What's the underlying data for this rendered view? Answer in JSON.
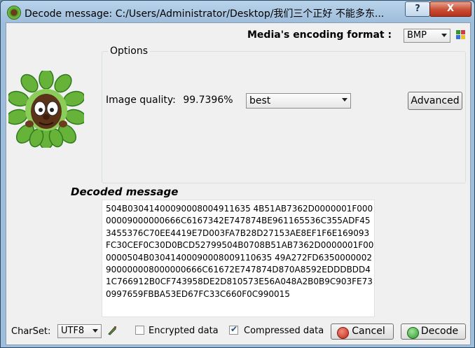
{
  "window": {
    "title": "Decode message: C:/Users/Administrator/Desktop/我们三个正好 不能多东...",
    "help_label": "?",
    "close_label": "X"
  },
  "encoding": {
    "label": "Media's encoding format :",
    "selected": "BMP"
  },
  "options": {
    "legend": "Options",
    "quality_label": "Image quality:",
    "quality_value": "99.7396%",
    "quality_preset": "best",
    "advanced_label": "Advanced"
  },
  "decoded": {
    "label": "Decoded message",
    "text": "504B03041400090008004911635 4B51AB7362D0000001F00000009000000666C6167342E747874BE961165536C355ADF453455376C70EE4419E7D003FA7B28D27153AE8EF1F6E169093FC30CEF0C30D0BCD52799504B0708B51AB7362D0000001F000000504B03041400090008009110635 49A272FD6350000002900000008000000666C61672E747874D870A8592EDDDBDD41C766912B0CF743958DE2D810573E56A048A2B0B9C903FE730997659FBBA53ED67FC33C660F0C990015"
  },
  "footer": {
    "charset_label": "CharSet:",
    "charset_value": "UTF8",
    "encrypted_label": "Encrypted data",
    "encrypted_checked": false,
    "compressed_label": "Compressed data",
    "compressed_checked": true,
    "cancel_label": "Cancel",
    "decode_label": "Decode"
  },
  "colors": {
    "titlebar": "#b9d3ea",
    "close_button": "#c94c33",
    "accent_green": "#2e9a2a"
  }
}
